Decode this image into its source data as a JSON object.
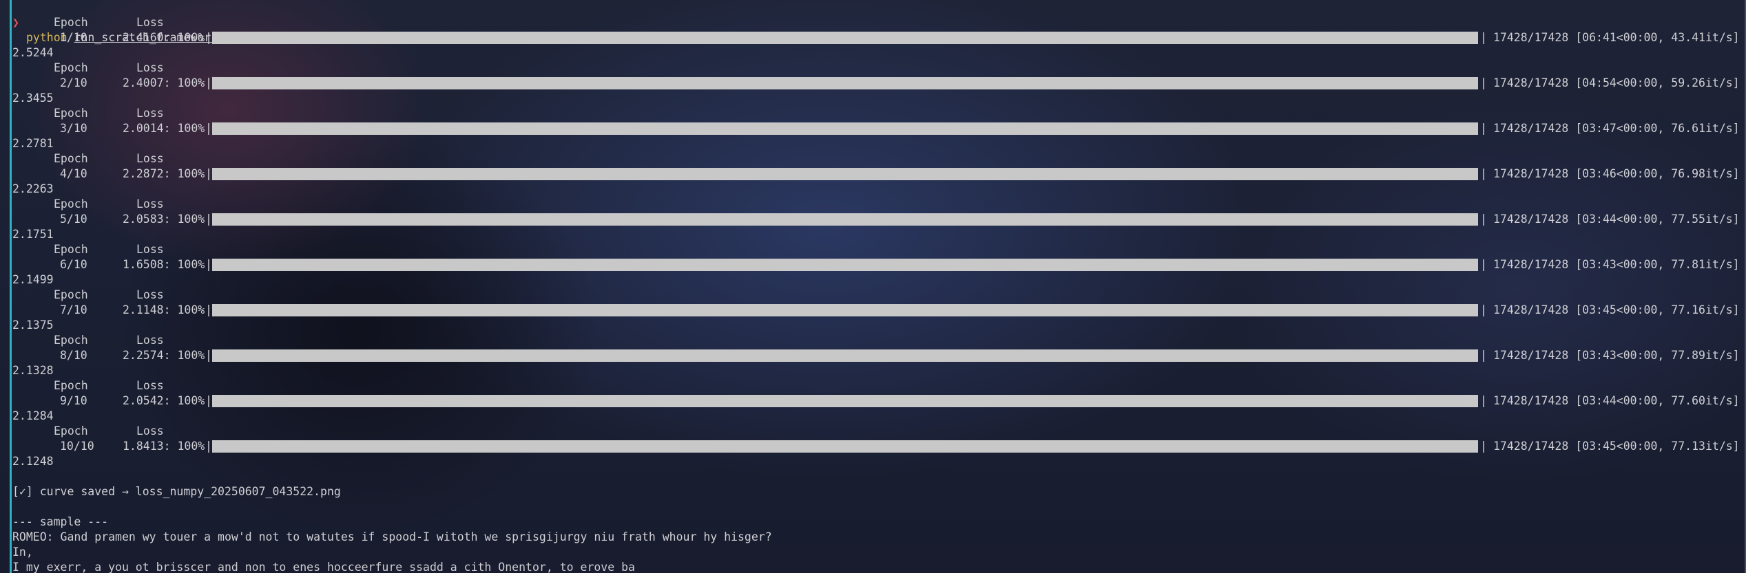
{
  "terminal": {
    "prompt_symbol": "❯",
    "command": "python",
    "command_arg": "rnn_scratch_framework.py",
    "header_epoch": "Epoch",
    "header_loss": "Loss",
    "epochs": [
      {
        "epoch": "1/10",
        "loss_text": "2.4160: 100%",
        "progress": 1.0,
        "stats": "17428/17428 [06:41<00:00, 43.41it/s]",
        "final_loss": "2.5244"
      },
      {
        "epoch": "2/10",
        "loss_text": "2.4007: 100%",
        "progress": 1.0,
        "stats": "17428/17428 [04:54<00:00, 59.26it/s]",
        "final_loss": "2.3455"
      },
      {
        "epoch": "3/10",
        "loss_text": "2.0014: 100%",
        "progress": 1.0,
        "stats": "17428/17428 [03:47<00:00, 76.61it/s]",
        "final_loss": "2.2781"
      },
      {
        "epoch": "4/10",
        "loss_text": "2.2872: 100%",
        "progress": 1.0,
        "stats": "17428/17428 [03:46<00:00, 76.98it/s]",
        "final_loss": "2.2263"
      },
      {
        "epoch": "5/10",
        "loss_text": "2.0583: 100%",
        "progress": 1.0,
        "stats": "17428/17428 [03:44<00:00, 77.55it/s]",
        "final_loss": "2.1751"
      },
      {
        "epoch": "6/10",
        "loss_text": "1.6508: 100%",
        "progress": 1.0,
        "stats": "17428/17428 [03:43<00:00, 77.81it/s]",
        "final_loss": "2.1499"
      },
      {
        "epoch": "7/10",
        "loss_text": "2.1148: 100%",
        "progress": 1.0,
        "stats": "17428/17428 [03:45<00:00, 77.16it/s]",
        "final_loss": "2.1375"
      },
      {
        "epoch": "8/10",
        "loss_text": "2.2574: 100%",
        "progress": 1.0,
        "stats": "17428/17428 [03:43<00:00, 77.89it/s]",
        "final_loss": "2.1328"
      },
      {
        "epoch": "9/10",
        "loss_text": "2.0542: 100%",
        "progress": 1.0,
        "stats": "17428/17428 [03:44<00:00, 77.60it/s]",
        "final_loss": "2.1284"
      },
      {
        "epoch": "10/10",
        "loss_text": "1.8413: 100%",
        "progress": 1.0,
        "stats": "17428/17428 [03:45<00:00, 77.13it/s]",
        "final_loss": "2.1248"
      }
    ],
    "saved_line": "[✓] curve saved → loss_numpy_20250607_043522.png",
    "sample_header": "--- sample ---",
    "sample_lines": [
      "ROMEO: Gand pramen wy touer a mow'd not to watutes if spood-I witoth we sprisgijurgy niu frath whour hy hisger?",
      "In,",
      "I my exerr, a you ot brisscer and non to enes hocceerfure ssadd a cith Onentor, to erove ba"
    ],
    "colors": {
      "accent": "#2fb3c4",
      "prompt": "#e0525a",
      "command": "#d6b85a",
      "bar_fill": "#c8c8c8",
      "text": "#cfcfd4"
    }
  }
}
